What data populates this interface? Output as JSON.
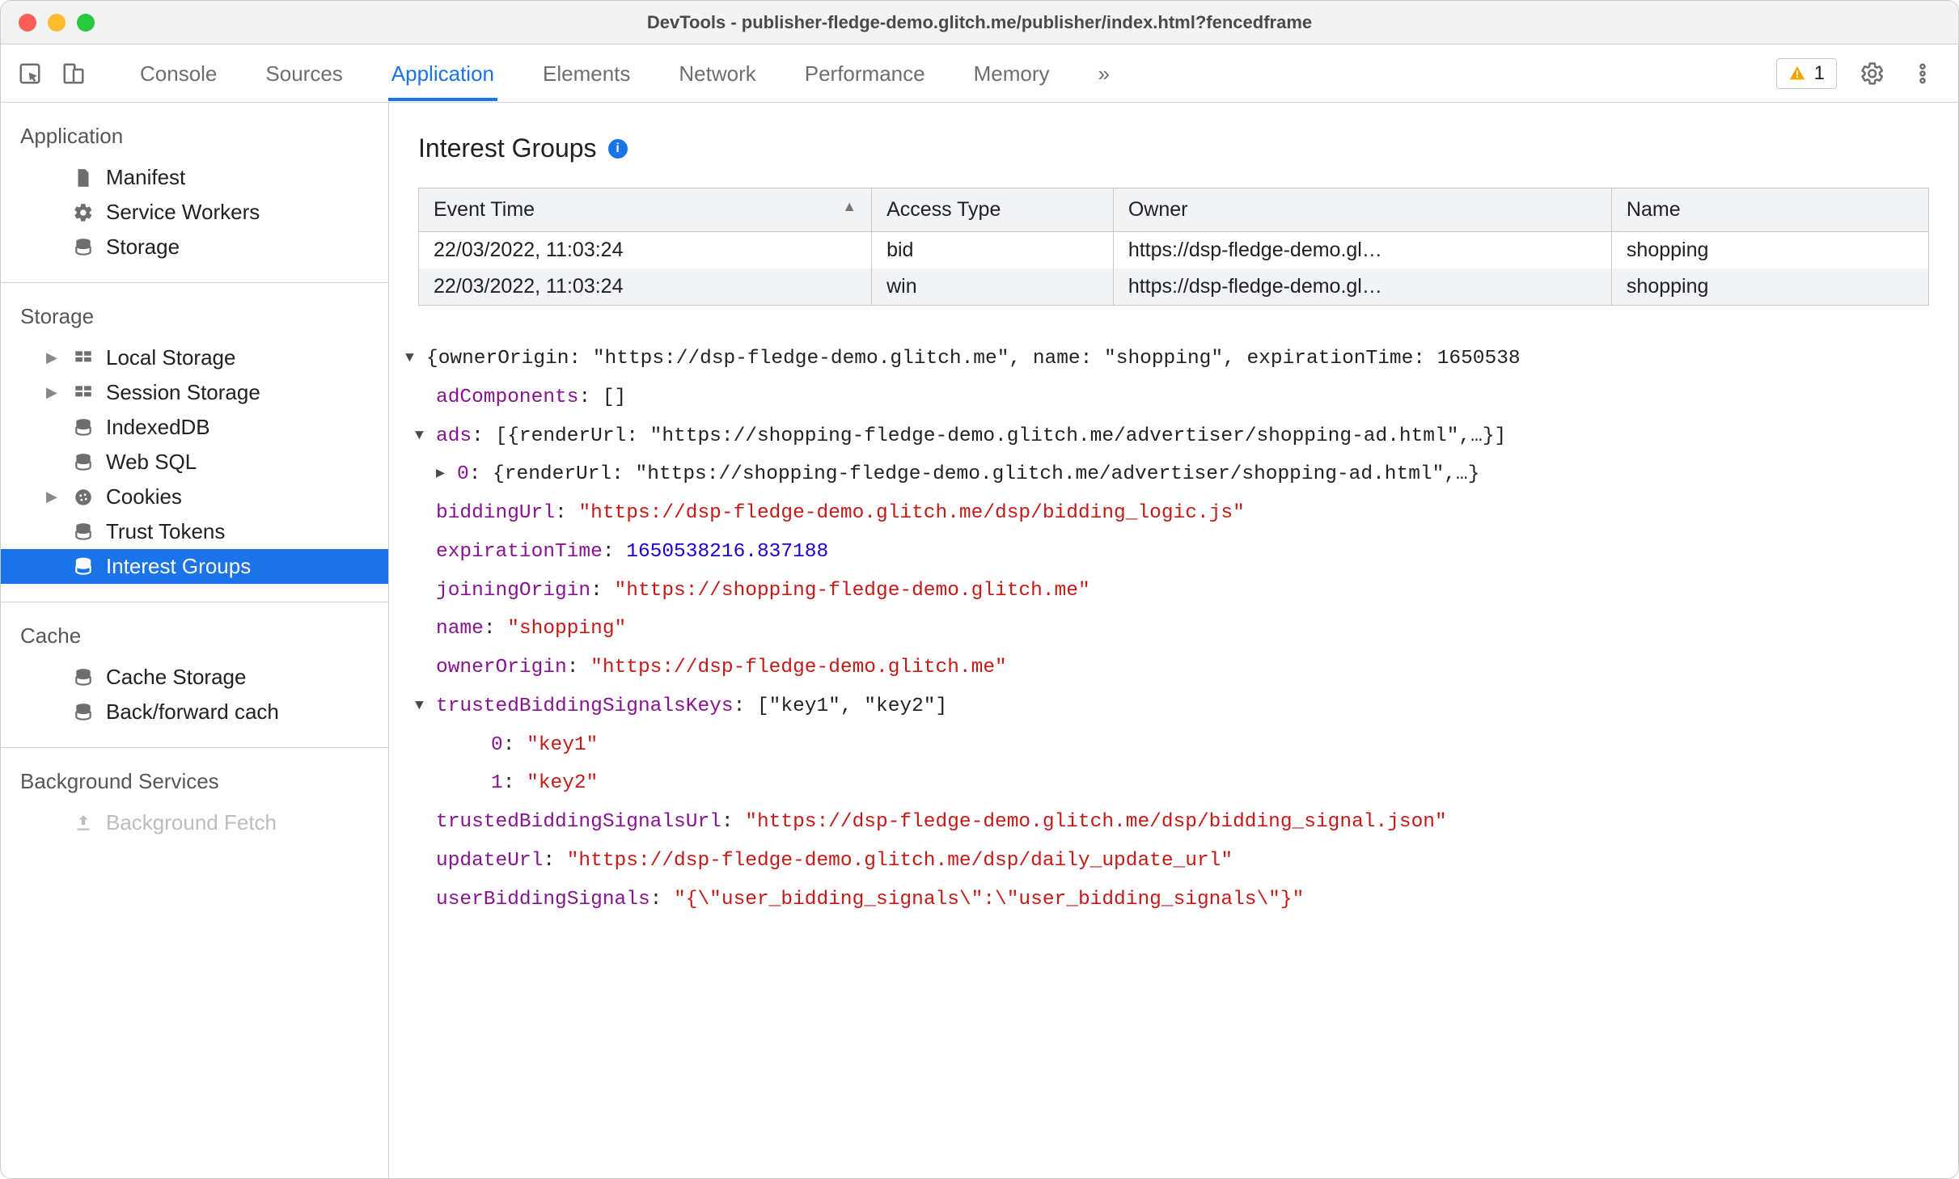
{
  "window": {
    "title": "DevTools - publisher-fledge-demo.glitch.me/publisher/index.html?fencedframe"
  },
  "toolbar": {
    "tabs": [
      "Console",
      "Sources",
      "Application",
      "Elements",
      "Network",
      "Performance",
      "Memory"
    ],
    "active_tab_index": 2,
    "more_glyph": "»",
    "issues_count": "1"
  },
  "sidebar": {
    "sections": [
      {
        "heading": "Application",
        "items": [
          {
            "icon": "file-icon",
            "label": "Manifest"
          },
          {
            "icon": "gear-icon",
            "label": "Service Workers"
          },
          {
            "icon": "database-icon",
            "label": "Storage"
          }
        ]
      },
      {
        "heading": "Storage",
        "items": [
          {
            "icon": "grid-icon",
            "label": "Local Storage",
            "expandable": true
          },
          {
            "icon": "grid-icon",
            "label": "Session Storage",
            "expandable": true
          },
          {
            "icon": "database-icon",
            "label": "IndexedDB"
          },
          {
            "icon": "database-icon",
            "label": "Web SQL"
          },
          {
            "icon": "cookie-icon",
            "label": "Cookies",
            "expandable": true
          },
          {
            "icon": "database-icon",
            "label": "Trust Tokens"
          },
          {
            "icon": "database-icon",
            "label": "Interest Groups",
            "selected": true
          }
        ]
      },
      {
        "heading": "Cache",
        "items": [
          {
            "icon": "database-icon",
            "label": "Cache Storage"
          },
          {
            "icon": "database-icon",
            "label": "Back/forward cach"
          }
        ]
      },
      {
        "heading": "Background Services",
        "items": [
          {
            "icon": "upload-icon",
            "label": "Background Fetch"
          }
        ]
      }
    ]
  },
  "main": {
    "title": "Interest Groups",
    "table": {
      "columns": [
        "Event Time",
        "Access Type",
        "Owner",
        "Name"
      ],
      "sorted_col": 0,
      "rows": [
        [
          "22/03/2022, 11:03:24",
          "bid",
          "https://dsp-fledge-demo.gl…",
          "shopping"
        ],
        [
          "22/03/2022, 11:03:24",
          "win",
          "https://dsp-fledge-demo.gl…",
          "shopping"
        ]
      ]
    },
    "details": {
      "topline": "{ownerOrigin: \"https://dsp-fledge-demo.glitch.me\", name: \"shopping\", expirationTime: 1650538",
      "adComponents_key": "adComponents",
      "adComponents_val": "[]",
      "ads_key": "ads",
      "ads_val": "[{renderUrl: \"https://shopping-fledge-demo.glitch.me/advertiser/shopping-ad.html\",…}]",
      "ads_idx0": "0",
      "ads_idx0_val": "{renderUrl: \"https://shopping-fledge-demo.glitch.me/advertiser/shopping-ad.html\",…}",
      "biddingUrl_key": "biddingUrl",
      "biddingUrl_val": "\"https://dsp-fledge-demo.glitch.me/dsp/bidding_logic.js\"",
      "expirationTime_key": "expirationTime",
      "expirationTime_val": "1650538216.837188",
      "joiningOrigin_key": "joiningOrigin",
      "joiningOrigin_val": "\"https://shopping-fledge-demo.glitch.me\"",
      "name_key": "name",
      "name_val": "\"shopping\"",
      "ownerOrigin_key": "ownerOrigin",
      "ownerOrigin_val": "\"https://dsp-fledge-demo.glitch.me\"",
      "tbsk_key": "trustedBiddingSignalsKeys",
      "tbsk_val": "[\"key1\", \"key2\"]",
      "tbsk_0_idx": "0",
      "tbsk_0_val": "\"key1\"",
      "tbsk_1_idx": "1",
      "tbsk_1_val": "\"key2\"",
      "tbsu_key": "trustedBiddingSignalsUrl",
      "tbsu_val": "\"https://dsp-fledge-demo.glitch.me/dsp/bidding_signal.json\"",
      "updateUrl_key": "updateUrl",
      "updateUrl_val": "\"https://dsp-fledge-demo.glitch.me/dsp/daily_update_url\"",
      "ubs_key": "userBiddingSignals",
      "ubs_val": "\"{\\\"user_bidding_signals\\\":\\\"user_bidding_signals\\\"}\""
    }
  }
}
